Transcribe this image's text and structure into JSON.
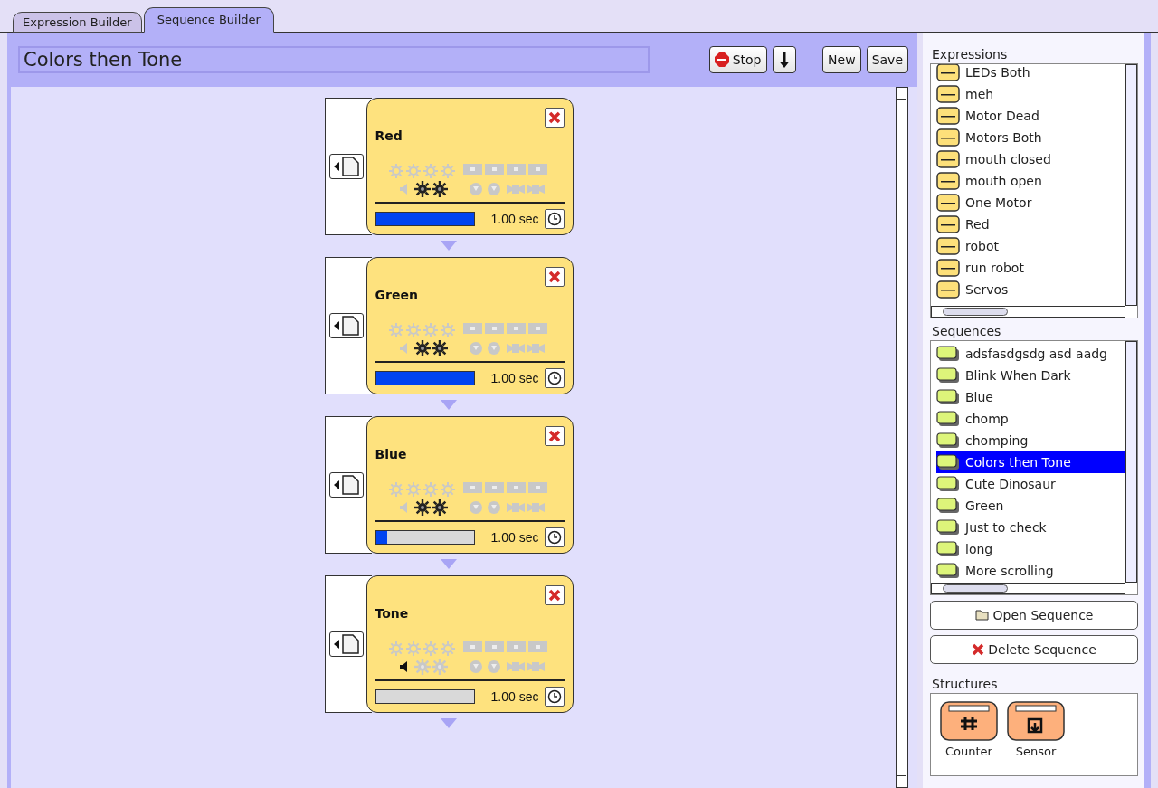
{
  "tabs": [
    {
      "label": "Expression Builder",
      "selected": false
    },
    {
      "label": "Sequence Builder",
      "selected": true
    }
  ],
  "sequence_title": {
    "value": "Colors then Tone"
  },
  "toolbar": [
    {
      "kind": "stop",
      "label": "Stop"
    },
    {
      "kind": "download"
    },
    {
      "kind": "text",
      "label": "New"
    },
    {
      "kind": "text",
      "label": "Save"
    }
  ],
  "steps": [
    {
      "name": "Red",
      "sound": false,
      "gears": true,
      "level": 1,
      "duration": "1.00 sec"
    },
    {
      "name": "Green",
      "sound": false,
      "gears": true,
      "level": 1,
      "duration": "1.00 sec"
    },
    {
      "name": "Blue",
      "sound": false,
      "gears": true,
      "level": 0.12,
      "duration": "1.00 sec"
    },
    {
      "name": "Tone",
      "sound": true,
      "gears": false,
      "level": 0,
      "duration": "1.00 sec"
    }
  ],
  "expressions": {
    "title": "Expressions",
    "items": [
      {
        "label": "LEDs Both",
        "selected": false
      },
      {
        "label": "meh",
        "selected": false
      },
      {
        "label": "Motor Dead",
        "selected": false
      },
      {
        "label": "Motors Both",
        "selected": false
      },
      {
        "label": "mouth closed",
        "selected": false
      },
      {
        "label": "mouth open",
        "selected": false
      },
      {
        "label": "One Motor",
        "selected": false
      },
      {
        "label": "Red",
        "selected": false
      },
      {
        "label": "robot",
        "selected": false
      },
      {
        "label": "run robot",
        "selected": false
      },
      {
        "label": "Servos",
        "selected": false
      }
    ]
  },
  "sequences": {
    "title": "Sequences",
    "items": [
      {
        "label": "adsfasdgsdg asd aadg",
        "selected": false
      },
      {
        "label": "Blink When Dark",
        "selected": false
      },
      {
        "label": "Blue",
        "selected": false
      },
      {
        "label": "chomp",
        "selected": false
      },
      {
        "label": "chomping",
        "selected": false
      },
      {
        "label": "Colors then Tone",
        "selected": true
      },
      {
        "label": "Cute Dinosaur",
        "selected": false
      },
      {
        "label": "Green",
        "selected": false
      },
      {
        "label": "Just to check",
        "selected": false
      },
      {
        "label": "long",
        "selected": false
      },
      {
        "label": "More scrolling",
        "selected": false
      }
    ]
  },
  "sequence_buttons": [
    {
      "kind": "open",
      "label": "Open Sequence"
    },
    {
      "kind": "delete",
      "label": "Delete Sequence"
    }
  ],
  "structures": {
    "title": "Structures",
    "items": [
      {
        "kind": "counter",
        "label": "Counter"
      },
      {
        "kind": "sensor",
        "label": "Sensor"
      }
    ]
  }
}
